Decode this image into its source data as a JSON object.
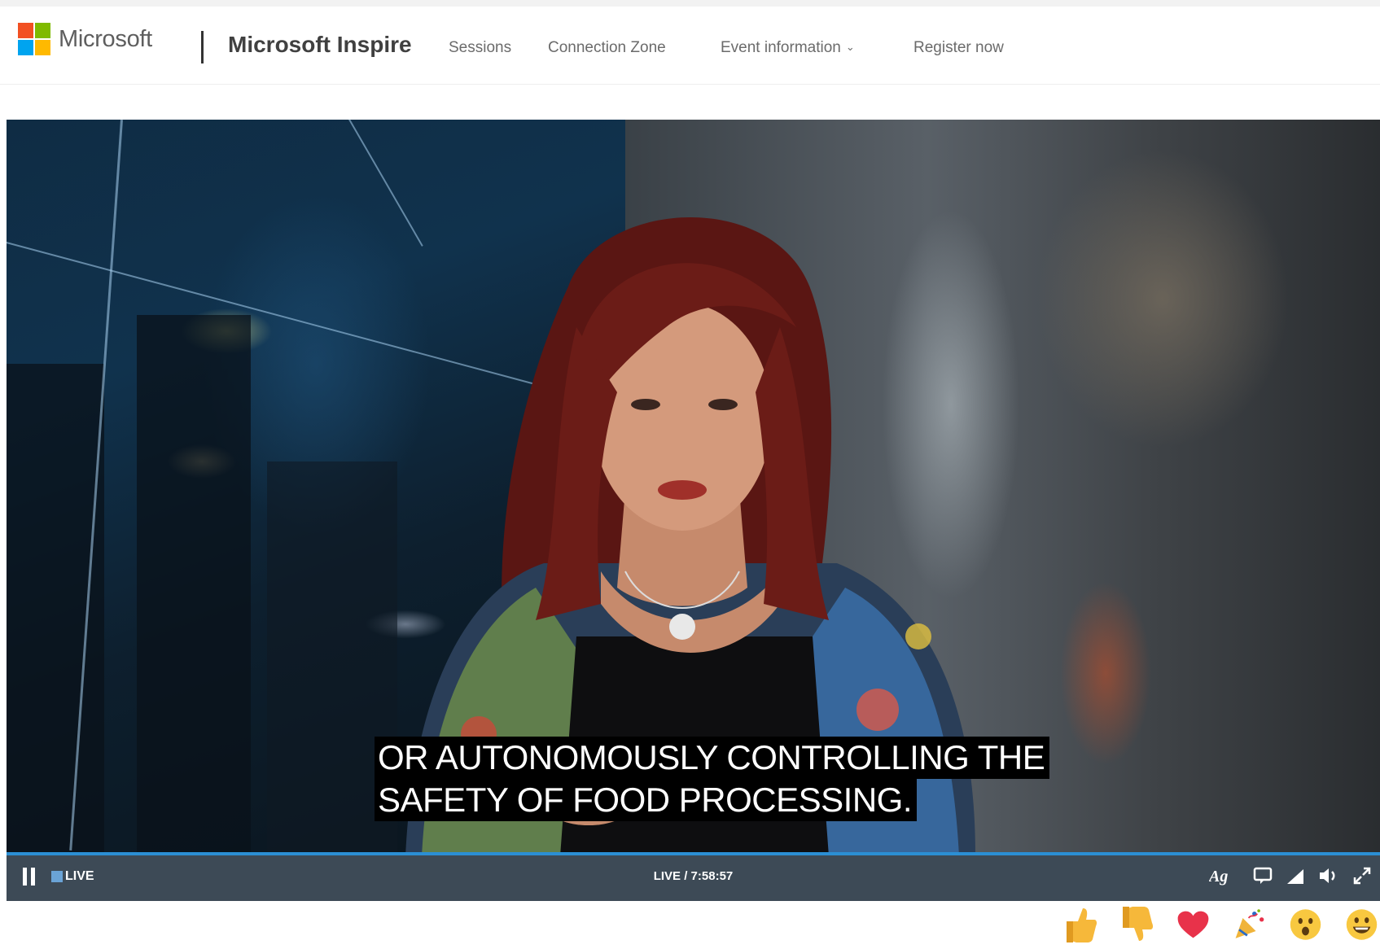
{
  "header": {
    "brand": "Microsoft",
    "site_title": "Microsoft Inspire",
    "nav": [
      {
        "label": "Sessions"
      },
      {
        "label": "Connection Zone"
      },
      {
        "label": "Event information"
      },
      {
        "label": "Register now"
      }
    ],
    "logo_colors": [
      "#f25022",
      "#7fba00",
      "#00a4ef",
      "#ffb900"
    ]
  },
  "video": {
    "captions": [
      "OR AUTONOMOUSLY CONTROLLING THE",
      "SAFETY OF FOOD PROCESSING."
    ],
    "player": {
      "live_label": "LIVE",
      "timecode": "LIVE / 7:58:57",
      "accent_color": "#2b8fd4"
    }
  },
  "reactions": [
    {
      "icon": "thumbs-up-icon"
    },
    {
      "icon": "thumbs-down-icon"
    },
    {
      "icon": "heart-icon"
    },
    {
      "icon": "party-popper-icon"
    },
    {
      "icon": "surprised-face-icon"
    },
    {
      "icon": "smiling-face-icon"
    }
  ]
}
